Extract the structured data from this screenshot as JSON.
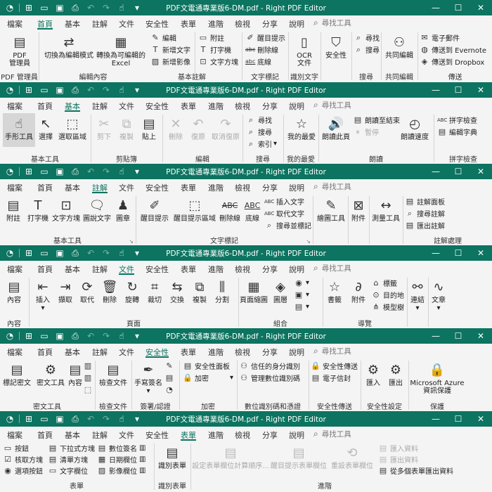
{
  "app": {
    "title": "PDF文電通專業版6-DM.pdf - Right PDF Editor",
    "search_placeholder": "尋找工具",
    "colors": {
      "titlebar": "#0c7460",
      "ribbon": "#f4f4f4",
      "accent": "#0c7460"
    },
    "window_controls": {
      "minimize": "—",
      "maximize": "☐",
      "close": "✕"
    }
  },
  "strips": [
    {
      "active_tab": "首頁",
      "tabs": [
        "檔案",
        "首頁",
        "基本",
        "註解",
        "文件",
        "安全性",
        "表單",
        "進階",
        "檢視",
        "分享",
        "說明"
      ],
      "buttons": {
        "pdf_admin": "PDF\n管理員",
        "to_edit": "切換為編輯模式",
        "to_excel": "轉換為可編輯的\nExcel",
        "edit": "編輯",
        "add_text": "新增文字",
        "add_image": "新增影像",
        "attach": "附註",
        "typewriter": "打字機",
        "textbox": "文字方塊",
        "highlight": "醒目提示",
        "strikeout": "刪除線",
        "underline": "底線",
        "ocr": "OCR\n文件",
        "security": "安全性",
        "find": "尋找",
        "search": "搜尋",
        "co_edit": "共同編輯",
        "email": "電子郵件",
        "evernote": "傳送到 Evernote",
        "dropbox": "傳送到 Dropbox"
      },
      "groups": [
        "PDF 管理員",
        "編輯內容",
        "基本註解",
        "文字標記",
        "識別文字",
        "",
        "搜尋",
        "共同編輯",
        "傳送"
      ]
    },
    {
      "active_tab": "基本",
      "tabs": [
        "檔案",
        "首頁",
        "基本",
        "註解",
        "文件",
        "安全性",
        "表單",
        "進階",
        "檢視",
        "分享",
        "說明"
      ],
      "buttons": {
        "hand": "手形工具",
        "select": "選擇",
        "select_area": "選取區域",
        "cut": "剪下",
        "copy": "複製",
        "paste": "貼上",
        "delete": "刪除",
        "undo": "復原",
        "redo": "取消復原",
        "find": "尋找",
        "search": "搜尋",
        "index": "索引",
        "favorites": "我的最愛",
        "read_page": "朗讀此頁",
        "read_to_end": "朗讀至結束",
        "pause": "暫停",
        "read_speed": "朗讀速度",
        "spell_check": "拼字檢查",
        "edit_dict": "編輯字典"
      },
      "groups": [
        "基本工具",
        "剪貼簿",
        "編輯",
        "搜尋",
        "我的最愛",
        "朗讀",
        "拼字檢查"
      ]
    },
    {
      "active_tab": "註解",
      "tabs": [
        "檔案",
        "首頁",
        "基本",
        "註解",
        "文件",
        "安全性",
        "表單",
        "進階",
        "檢視",
        "分享",
        "說明"
      ],
      "buttons": {
        "attach": "附註",
        "typewriter": "打字機",
        "textbox": "文字方塊",
        "callout": "圖說文字",
        "stamp": "圖章",
        "highlight": "醒目提示",
        "highlight_area": "醒目提示區域",
        "strikeout": "刪除線",
        "underline": "底線",
        "insert_text": "插入文字",
        "replace_text": "取代文字",
        "search_mark": "搜尋並標記",
        "draw_tools": "繪圖工具",
        "attachment": "附件",
        "measure": "測量工具",
        "comment_panel": "註解面板",
        "search_comment": "搜尋註解",
        "export_comment": "匯出註解"
      },
      "groups": [
        "基本工具",
        "文字標記",
        "",
        "",
        "",
        "註解處理"
      ]
    },
    {
      "active_tab": "文件",
      "tabs": [
        "檔案",
        "首頁",
        "基本",
        "註解",
        "文件",
        "安全性",
        "表單",
        "進階",
        "檢視",
        "分享",
        "說明"
      ],
      "buttons": {
        "content": "內容",
        "insert": "插入",
        "extract": "擷取",
        "replace": "取代",
        "delete": "刪除",
        "rotate": "旋轉",
        "crop": "裁切",
        "swap": "交換",
        "duplicate": "複製",
        "split": "分割",
        "thumbnails": "頁面縮圖",
        "layers": "圖層",
        "bookmark": "書籤",
        "attachment": "附件",
        "label": "標籤",
        "destination": "目的地",
        "model_tree": "模型樹",
        "link": "連結",
        "article": "文章"
      },
      "groups": [
        "內容",
        "頁面",
        "組合",
        "導覽"
      ]
    },
    {
      "active_tab": "安全性",
      "tabs": [
        "檔案",
        "首頁",
        "基本",
        "註解",
        "文件",
        "安全性",
        "表單",
        "進階",
        "檢視",
        "分享",
        "說明"
      ],
      "buttons": {
        "redact_text": "標記密文",
        "redact_tool": "密文工具",
        "content": "內容",
        "check_doc": "檢查文件",
        "sign": "手寫簽名",
        "security_panel": "安全性面板",
        "encrypt": "加密",
        "trusted_ids": "信任的身分識別",
        "manage_ids": "管理數位識別碼",
        "secure_send": "安全性傳送",
        "secure_envelope": "電子信封",
        "import": "匯入",
        "export": "匯出",
        "azure": "Microsoft Azure\n資訊保護"
      },
      "groups": [
        "密文工具",
        "檢查文件",
        "簽署/認證",
        "加密",
        "數位識別碼和憑證",
        "安全性傳送",
        "安全性設定",
        "保護"
      ]
    },
    {
      "active_tab": "表單",
      "tabs": [
        "檔案",
        "首頁",
        "基本",
        "註解",
        "文件",
        "安全性",
        "表單",
        "進階",
        "檢視",
        "分享",
        "說明"
      ],
      "buttons": {
        "button": "按鈕",
        "dropdown": "下拉式方塊",
        "digital_sig": "數位簽名",
        "checkbox": "核取方塊",
        "listbox": "清單方塊",
        "date_field": "日期欄位",
        "radio": "選項按鈕",
        "text_field": "文字欄位",
        "image_field": "影像欄位",
        "identify_form": "識別表單",
        "calc_order": "設定表單欄位計算順序...",
        "highlight_fields": "醒目提示表單欄位",
        "reset_form": "重設表單欄位",
        "import_data": "匯入資料",
        "export_data": "匯出資料",
        "export_multi": "從多個表單匯出資料"
      },
      "groups": [
        "表單",
        "識別表單",
        "進階"
      ]
    }
  ]
}
